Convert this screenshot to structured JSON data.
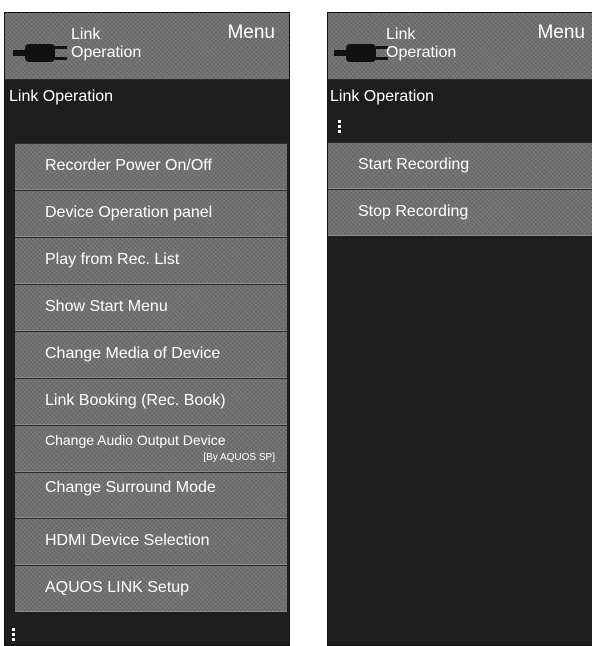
{
  "left_panel": {
    "menu_title": "Menu",
    "header_line1": "Link",
    "header_line2": "Operation",
    "subtitle": "Link Operation",
    "items": [
      {
        "label": "Recorder Power On/Off"
      },
      {
        "label": "Device Operation panel"
      },
      {
        "label": "Play from Rec. List"
      },
      {
        "label": "Show Start Menu"
      },
      {
        "label": "Change Media of Device"
      },
      {
        "label": "Link Booking (Rec. Book)"
      },
      {
        "label": "Change Audio Output Device",
        "sublabel": "[By AQUOS SP]"
      },
      {
        "label": "Change Surround Mode"
      },
      {
        "label": "HDMI Device Selection"
      },
      {
        "label": "AQUOS LINK Setup"
      }
    ]
  },
  "right_panel": {
    "menu_title": "Menu",
    "header_line1": "Link",
    "header_line2": "Operation",
    "subtitle": "Link Operation",
    "items": [
      {
        "label": "Start Recording"
      },
      {
        "label": "Stop Recording"
      }
    ]
  }
}
